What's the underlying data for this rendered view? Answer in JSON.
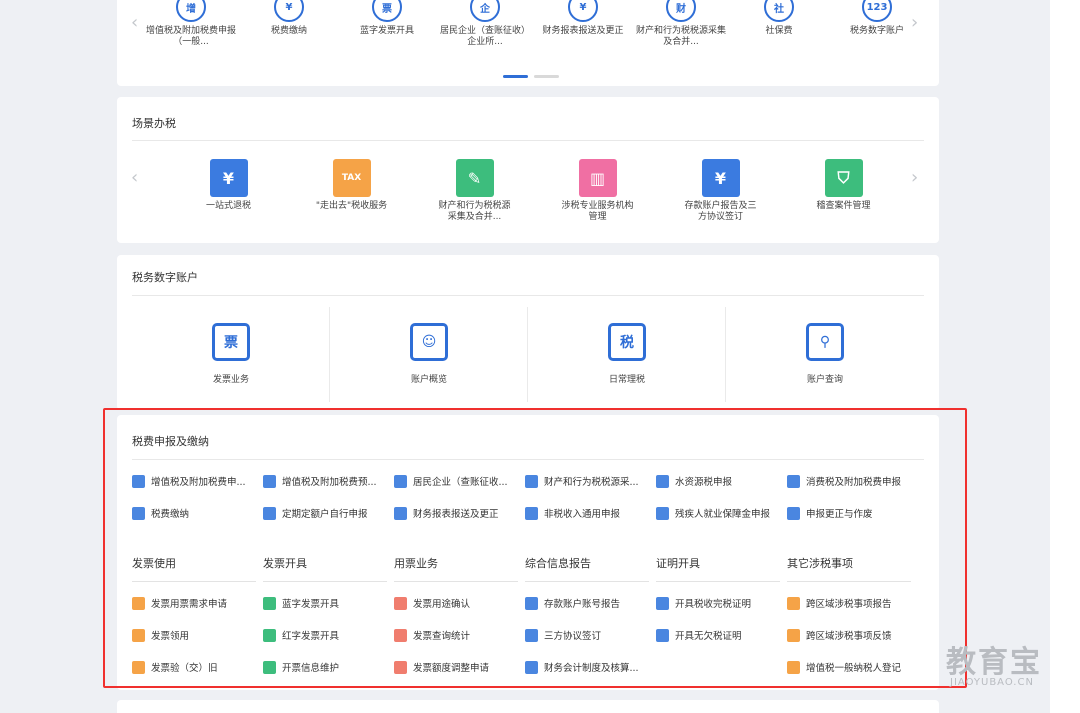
{
  "top_services": {
    "items": [
      {
        "label": "增值税及附加税费申报（一般...",
        "glyph": "增",
        "icon": "vat-declare-icon"
      },
      {
        "label": "税费缴纳",
        "glyph": "¥",
        "icon": "tax-payment-icon"
      },
      {
        "label": "蓝字发票开具",
        "glyph": "票",
        "icon": "blue-invoice-icon"
      },
      {
        "label": "居民企业（查账征收）企业所...",
        "glyph": "企",
        "icon": "enterprise-income-tax-icon"
      },
      {
        "label": "财务报表报送及更正",
        "glyph": "¥",
        "icon": "financial-report-icon"
      },
      {
        "label": "财产和行为税税源采集及合并...",
        "glyph": "财",
        "icon": "property-tax-icon"
      },
      {
        "label": "社保费",
        "glyph": "社",
        "icon": "social-insurance-icon"
      },
      {
        "label": "税务数字账户",
        "glyph": "123",
        "icon": "digital-account-icon"
      }
    ],
    "prev": "‹",
    "next": "›"
  },
  "scenario": {
    "title": "场景办税",
    "prev": "‹",
    "next": "›",
    "items": [
      {
        "label": "一站式退税",
        "color": "#3b7be0",
        "glyph": "¥",
        "icon": "one-stop-refund-icon"
      },
      {
        "label": "\"走出去\"税收服务",
        "color": "#f5a347",
        "glyph": "TAX",
        "icon": "going-global-tax-icon"
      },
      {
        "label": "财产和行为税税源采集及合并...",
        "color": "#3dbd7d",
        "glyph": "✎",
        "icon": "property-source-icon"
      },
      {
        "label": "涉税专业服务机构管理",
        "color": "#f06fa3",
        "glyph": "▥",
        "icon": "tax-agency-icon"
      },
      {
        "label": "存款账户报告及三方协议签订",
        "color": "#3b7be0",
        "glyph": "¥",
        "icon": "deposit-account-icon"
      },
      {
        "label": "稽查案件管理",
        "color": "#3dbd7d",
        "glyph": "⛉",
        "icon": "audit-case-icon"
      }
    ]
  },
  "digital_account": {
    "title": "税务数字账户",
    "items": [
      {
        "label": "发票业务",
        "glyph": "票",
        "icon": "invoice-business-icon"
      },
      {
        "label": "账户概览",
        "glyph": "☺",
        "icon": "account-overview-icon"
      },
      {
        "label": "日常理税",
        "glyph": "税",
        "icon": "daily-tax-icon"
      },
      {
        "label": "账户查询",
        "glyph": "⚲",
        "icon": "account-query-icon"
      }
    ]
  },
  "declare": {
    "title": "税费申报及缴纳",
    "row1": [
      {
        "label": "增值税及附加税费申...",
        "color": "#4a86e0"
      },
      {
        "label": "增值税及附加税费预...",
        "color": "#4a86e0"
      },
      {
        "label": "居民企业（查账征收...",
        "color": "#4a86e0"
      },
      {
        "label": "财产和行为税税源采...",
        "color": "#4a86e0"
      },
      {
        "label": "水资源税申报",
        "color": "#4a86e0"
      },
      {
        "label": "消费税及附加税费申报",
        "color": "#4a86e0"
      }
    ],
    "row2": [
      {
        "label": "税费缴纳",
        "color": "#4a86e0"
      },
      {
        "label": "定期定额户自行申报",
        "color": "#4a86e0"
      },
      {
        "label": "财务报表报送及更正",
        "color": "#4a86e0"
      },
      {
        "label": "非税收入通用申报",
        "color": "#4a86e0"
      },
      {
        "label": "残疾人就业保障金申报",
        "color": "#4a86e0"
      },
      {
        "label": "申报更正与作废",
        "color": "#4a86e0"
      }
    ],
    "sections": [
      {
        "title": "发票使用",
        "items": [
          {
            "label": "发票用票需求申请",
            "color": "#f5a347"
          },
          {
            "label": "发票领用",
            "color": "#f5a347"
          },
          {
            "label": "发票验（交）旧",
            "color": "#f5a347"
          }
        ]
      },
      {
        "title": "发票开具",
        "items": [
          {
            "label": "蓝字发票开具",
            "color": "#3dbd7d"
          },
          {
            "label": "红字发票开具",
            "color": "#3dbd7d"
          },
          {
            "label": "开票信息维护",
            "color": "#3dbd7d"
          }
        ]
      },
      {
        "title": "用票业务",
        "items": [
          {
            "label": "发票用途确认",
            "color": "#f07d6e"
          },
          {
            "label": "发票查询统计",
            "color": "#f07d6e"
          },
          {
            "label": "发票额度调整申请",
            "color": "#f07d6e"
          }
        ]
      },
      {
        "title": "综合信息报告",
        "items": [
          {
            "label": "存款账户账号报告",
            "color": "#4a86e0"
          },
          {
            "label": "三方协议签订",
            "color": "#4a86e0"
          },
          {
            "label": "财务会计制度及核算...",
            "color": "#4a86e0"
          }
        ]
      },
      {
        "title": "证明开具",
        "items": [
          {
            "label": "开具税收完税证明",
            "color": "#4a86e0"
          },
          {
            "label": "开具无欠税证明",
            "color": "#4a86e0"
          }
        ]
      },
      {
        "title": "其它涉税事项",
        "items": [
          {
            "label": "跨区域涉税事项报告",
            "color": "#f5a347"
          },
          {
            "label": "跨区域涉税事项反馈",
            "color": "#f5a347"
          },
          {
            "label": "增值税一般纳税人登记",
            "color": "#f5a347"
          }
        ]
      }
    ]
  },
  "watermark": {
    "text": "教育宝",
    "domain": "JIAOYUBAO.CN"
  },
  "colors": {
    "primary": "#2f6ed6",
    "highlight_border": "#f0302e"
  }
}
